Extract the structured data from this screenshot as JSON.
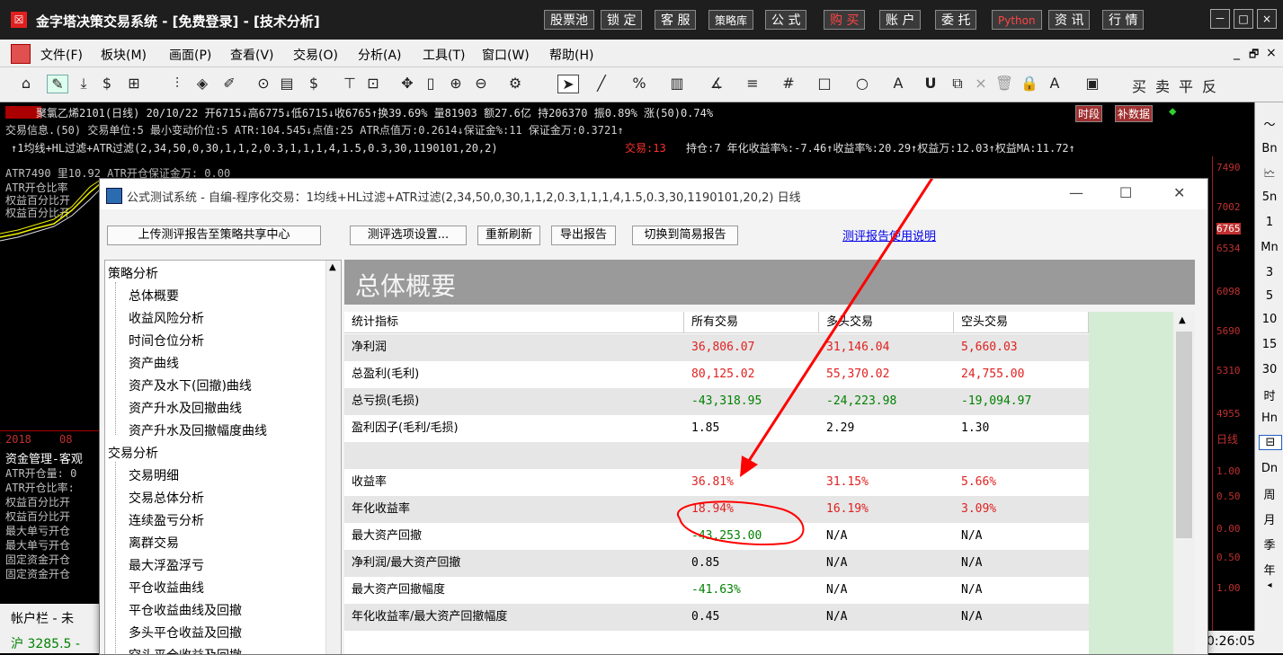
{
  "app": {
    "logo": "☒",
    "title": "金字塔决策交易系统 - [免费登录] - [技术分析]"
  },
  "titlebar_buttons": [
    "股票池",
    "锁 定",
    "客 服",
    "策略库",
    "公 式",
    "购 买",
    "账 户",
    "委 托",
    "Python",
    "资 讯",
    "行 情"
  ],
  "window_controls": {
    "minimize": "－",
    "restore": "□",
    "close": "×"
  },
  "menu": [
    "文件(F)",
    "板块(M)",
    "画面(P)",
    "查看(V)",
    "交易(O)",
    "分析(A)",
    "工具(T)",
    "窗口(W)",
    "帮助(H)"
  ],
  "menu_right": {
    "min": "_",
    "restore": "🗗",
    "close": "×"
  },
  "toolbar_icons": [
    "home-icon",
    "pencil-icon",
    "download-icon",
    "dollar-refresh-icon",
    "grid-icon",
    "bar-chart-icon",
    "compass-icon",
    "edit-icon",
    "play-circle-icon",
    "doc-icon",
    "dollar-icon",
    "filter-icon",
    "frame-icon",
    "move-icon",
    "bar-icon",
    "zoom-in-icon",
    "zoom-out-icon",
    "settings-icon",
    "pointer-icon",
    "line-icon",
    "percent-icon",
    "box-icon",
    "angle-icon",
    "list-icon",
    "hash-icon",
    "rect-icon",
    "circle-icon",
    "text-icon",
    "U-icon",
    "copy-icon",
    "close-x-icon",
    "trash-icon",
    "lock-icon",
    "text-color-icon",
    "save-icon",
    "buy-icon",
    "sell-icon",
    "flat-icon",
    "reverse-icon"
  ],
  "toolbar_right_labels": [
    "买",
    "卖",
    "平",
    "反"
  ],
  "chart": {
    "line1": "聚氯乙烯2101(日线) 20/10/22 开6715↓高6775↓低6715↓收6765↑换39.69% 量81903 额27.6亿 持206370 振0.89% 涨(50)0.74%",
    "line1_badges": [
      "时段",
      "补数据"
    ],
    "line2": "交易信息.(50) 交易单位:5 最小变动价位:5 ATR:104.545↓点值:25 ATR点值万:0.2614↓保证金%:11 保证金万:0.3721↑",
    "line3a": "↑1均线+HL过滤+ATR过滤(2,34,50,0,30,1,1,2,0.3,1,1,1,4,1.5,0.3,30,1190101,20,2)",
    "line3b": "交易:13",
    "line3c": "持仓:7 年化收益率%:-7.46↑收益率%:20.29↑权益万:12.03↑权益MA:11.72↑",
    "line4": "ATR7490 里10.92        ATR开仓保证金万: 0.00",
    "side_labels": [
      "ATR开仓比率",
      "权益百分比开",
      "权益百分比开"
    ],
    "bottom_labels": [
      "2018",
      "08"
    ],
    "lower_panel_title": "资金管理-客观",
    "lower_labels": [
      "ATR开仓量: 0",
      "ATR开仓比率:",
      "权益百分比开",
      "权益百分比开",
      "最大单亏开仓",
      "最大单亏开仓",
      "固定资金开仓",
      "固定资金开仓"
    ],
    "price_ticks": [
      "7490",
      "7002",
      "6765",
      "6534",
      "6098",
      "5690",
      "5310",
      "4955"
    ],
    "lower_ticks": [
      "日线",
      "1.00",
      "0.50",
      "0.00",
      "0.50",
      "1.00"
    ]
  },
  "right_panel": [
    "〜",
    "Bn",
    "🗠",
    "5n",
    "1",
    "Mn",
    "3",
    "5",
    "10",
    "15",
    "30",
    "时",
    "Hn",
    "⊟",
    "Dn",
    "周",
    "月",
    "季",
    "年",
    "◂"
  ],
  "dialog": {
    "title": "公式测试系统 - 自编-程序化交易：1均线+HL过滤+ATR过滤(2,34,50,0,30,1,1,2,0.3,1,1,1,4,1.5,0.3,30,1190101,20,2) 日线",
    "controls": {
      "min": "—",
      "max": "☐",
      "close": "✕"
    },
    "buttons": {
      "upload": "上传测评报告至策略共享中心",
      "options": "测评选项设置...",
      "refresh": "重新刷新",
      "export": "导出报告",
      "switch": "切换到简易报告"
    },
    "help_link": "测评报告使用说明",
    "tree": {
      "group1": "策略分析",
      "group1_items": [
        "总体概要",
        "收益风险分析",
        "时间仓位分析",
        "资产曲线",
        "资产及水下(回撤)曲线",
        "资产升水及回撤曲线",
        "资产升水及回撤幅度曲线"
      ],
      "group2": "交易分析",
      "group2_items": [
        "交易明细",
        "交易总体分析",
        "连续盈亏分析",
        "离群交易",
        "最大浮盈浮亏",
        "平仓收益曲线",
        "平仓收益曲线及回撤",
        "多头平仓收益及回撤",
        "空头平仓收益及回撤"
      ]
    },
    "summary_title": "总体概要",
    "table": {
      "headers": [
        "统计指标",
        "所有交易",
        "多头交易",
        "空头交易"
      ],
      "rows": [
        {
          "label": "净利润",
          "all": "36,806.07",
          "long": "31,146.04",
          "short": "5,660.03",
          "color": "red"
        },
        {
          "label": "总盈利(毛利)",
          "all": "80,125.02",
          "long": "55,370.02",
          "short": "24,755.00",
          "color": "red"
        },
        {
          "label": "总亏损(毛损)",
          "all": "-43,318.95",
          "long": "-24,223.98",
          "short": "-19,094.97",
          "color": "green"
        },
        {
          "label": "盈利因子(毛利/毛损)",
          "all": "1.85",
          "long": "2.29",
          "short": "1.30",
          "color": "black"
        },
        {
          "label": "",
          "all": "",
          "long": "",
          "short": "",
          "color": "black"
        },
        {
          "label": "收益率",
          "all": "36.81%",
          "long": "31.15%",
          "short": "5.66%",
          "color": "red"
        },
        {
          "label": "年化收益率",
          "all": "18.94%",
          "long": "16.19%",
          "short": "3.09%",
          "color": "red"
        },
        {
          "label": "最大资产回撤",
          "all": "-43,253.00",
          "long": "N/A",
          "short": "N/A",
          "color": "green"
        },
        {
          "label": "净利润/最大资产回撤",
          "all": "0.85",
          "long": "N/A",
          "short": "N/A",
          "color": "black"
        },
        {
          "label": "最大资产回撤幅度",
          "all": "-41.63%",
          "long": "N/A",
          "short": "N/A",
          "color": "green"
        },
        {
          "label": "年化收益率/最大资产回撤幅度",
          "all": "0.45",
          "long": "N/A",
          "short": "N/A",
          "color": "black"
        }
      ]
    }
  },
  "bottom": {
    "account_bar": "帐户栏 - 未",
    "status_index": "沪 3285.5 -",
    "clock": "0:26:05"
  },
  "colors": {
    "accent_red": "#e02020",
    "positive": "#e02020",
    "negative": "#008000",
    "annotation": "#ff0000"
  }
}
